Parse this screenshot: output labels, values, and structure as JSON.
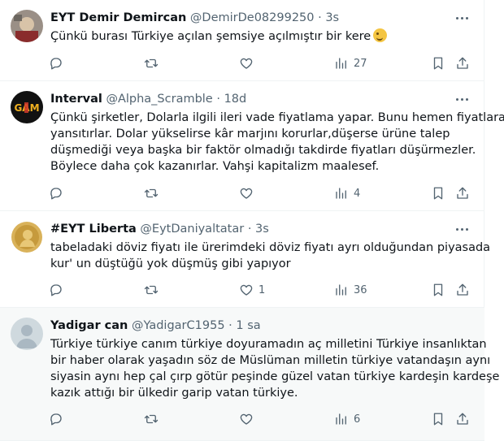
{
  "tweets": [
    {
      "name": "EYT Demir Demircan",
      "handle": "@DemirDe08299250",
      "dot": "·",
      "time": "3s",
      "lines": [
        "Çünkü burası Türkiye açılan şemsiye açılmıştır bir kere"
      ],
      "emoji": "wink-emoji",
      "replies": "",
      "retweets": "",
      "likes": "",
      "views": "27"
    },
    {
      "name": "Interval",
      "handle": "@Alpha_Scramble",
      "dot": "·",
      "time": "18d",
      "lines": [
        "Çünkü şirketler, Dolarla ilgili ileri vade fiyatlama yapar. Bunu hemen fiyatlara",
        "yansıtırlar. Dolar yükselirse kâr marjını korurlar,düşerse ürüne talep",
        "düşmediği veya başka bir faktör olmadığı takdirde fiyatları düşürmezler.",
        "Böylece daha çok kazanırlar. Vahşi kapitalizm maalesef."
      ],
      "avatar_text": "GAM",
      "replies": "",
      "retweets": "",
      "likes": "",
      "views": "4"
    },
    {
      "name": "#EYT Liberta",
      "handle": "@EytDaniyaltatar",
      "dot": "·",
      "time": "3s",
      "lines": [
        "tabeladaki döviz fiyatı ile ürerimdeki döviz fiyatı ayrı olduğundan piyasada",
        "kur' un düştüğü yok düşmüş gibi yapıyor"
      ],
      "replies": "",
      "retweets": "",
      "likes": "1",
      "views": "36"
    },
    {
      "name": "Yadigar can",
      "handle": "@YadigarC1955",
      "dot": "·",
      "time": "1 sa",
      "lines": [
        "Türkiye türkiye canım türkiye doyuramadın aç milletini Türkiye insanlıktan",
        "bir haber olarak yaşadın söz de Müslüman milletin türkiye vatandaşın aynı",
        "siyasin aynı hep çal çırp götür peşinde güzel vatan türkiye kardeşin kardeşe",
        "kazık attığı bir ülkedir garip vatan türkiye."
      ],
      "replies": "",
      "retweets": "",
      "likes": "",
      "views": "6"
    }
  ],
  "colors": {
    "text": "#0f1419",
    "secondary": "#536471",
    "border": "#eff3f4",
    "highlight": "#f7f9f9"
  }
}
